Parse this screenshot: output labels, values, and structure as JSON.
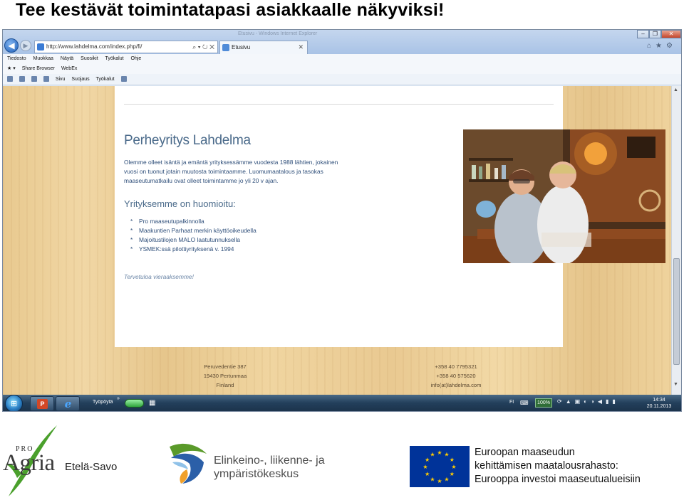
{
  "slide": {
    "title": "Tee kestävät toimintatapasi asiakkaalle näkyviksi!"
  },
  "browser": {
    "window_title_faint": "Etusivu - Windows Internet Explorer",
    "address_url": "http://www.lahdelma.com/index.php/fi/",
    "tab_label": "Etusivu",
    "menu": [
      "Tiedosto",
      "Muokkaa",
      "Näytä",
      "Suosikit",
      "Työkalut",
      "Ohje"
    ],
    "favorites": [
      "Share Browser",
      "WebEx"
    ],
    "commands": [
      "Sivu",
      "Suojaus",
      "Työkalut"
    ]
  },
  "website": {
    "company_heading": "Perheyritys Lahdelma",
    "intro": "Olemme olleet isäntä ja emäntä yrityksessämme vuodesta 1988 lähtien, jokainen vuosi on tuonut jotain muutosta toimintaamme. Luomumaatalous ja tasokas maaseutumatkailu ovat olleet toimintamme jo yli 20 v ajan.",
    "noted_heading": "Yrityksemme on huomioitu:",
    "noted_items": [
      "Pro maaseutupalkinnolla",
      "Maakuntien Parhaat merkin käyttöoikeudella",
      "Majoitustilojen MALO laatutunnuksella",
      "YSMEK:ssä pilottiyrityksenä v. 1994"
    ],
    "welcome": "Tervetuloa vieraaksemme!",
    "footer_address": [
      "Peruvedentie 387",
      "19430 Pertunmaa",
      "Finland"
    ],
    "footer_contact": [
      "+358 40 7795321",
      "+358 40 575620",
      "info(at)lahdelma.com"
    ]
  },
  "taskbar": {
    "desktop_label": "Työpöytä",
    "language": "FI",
    "zoom": "100%",
    "time": "14:34",
    "date": "20.11.2013"
  },
  "logos": {
    "proagria_pro": "PRO",
    "proagria_agria": "Agria",
    "proagria_region": "Etelä-Savo",
    "ely_line1": "Elinkeino-, liikenne- ja",
    "ely_line2": "ympäristökeskus",
    "eu_line1": "Euroopan maaseudun",
    "eu_line2": "kehittämisen maatalousrahasto:",
    "eu_line3": "Eurooppa investoi maaseutualueisiin"
  },
  "colors": {
    "wood": "#e9c991",
    "heading_blue": "#4a6a8a",
    "eu_blue": "#003399",
    "eu_star": "#ffcc00",
    "proagria_green": "#4aa02c"
  }
}
